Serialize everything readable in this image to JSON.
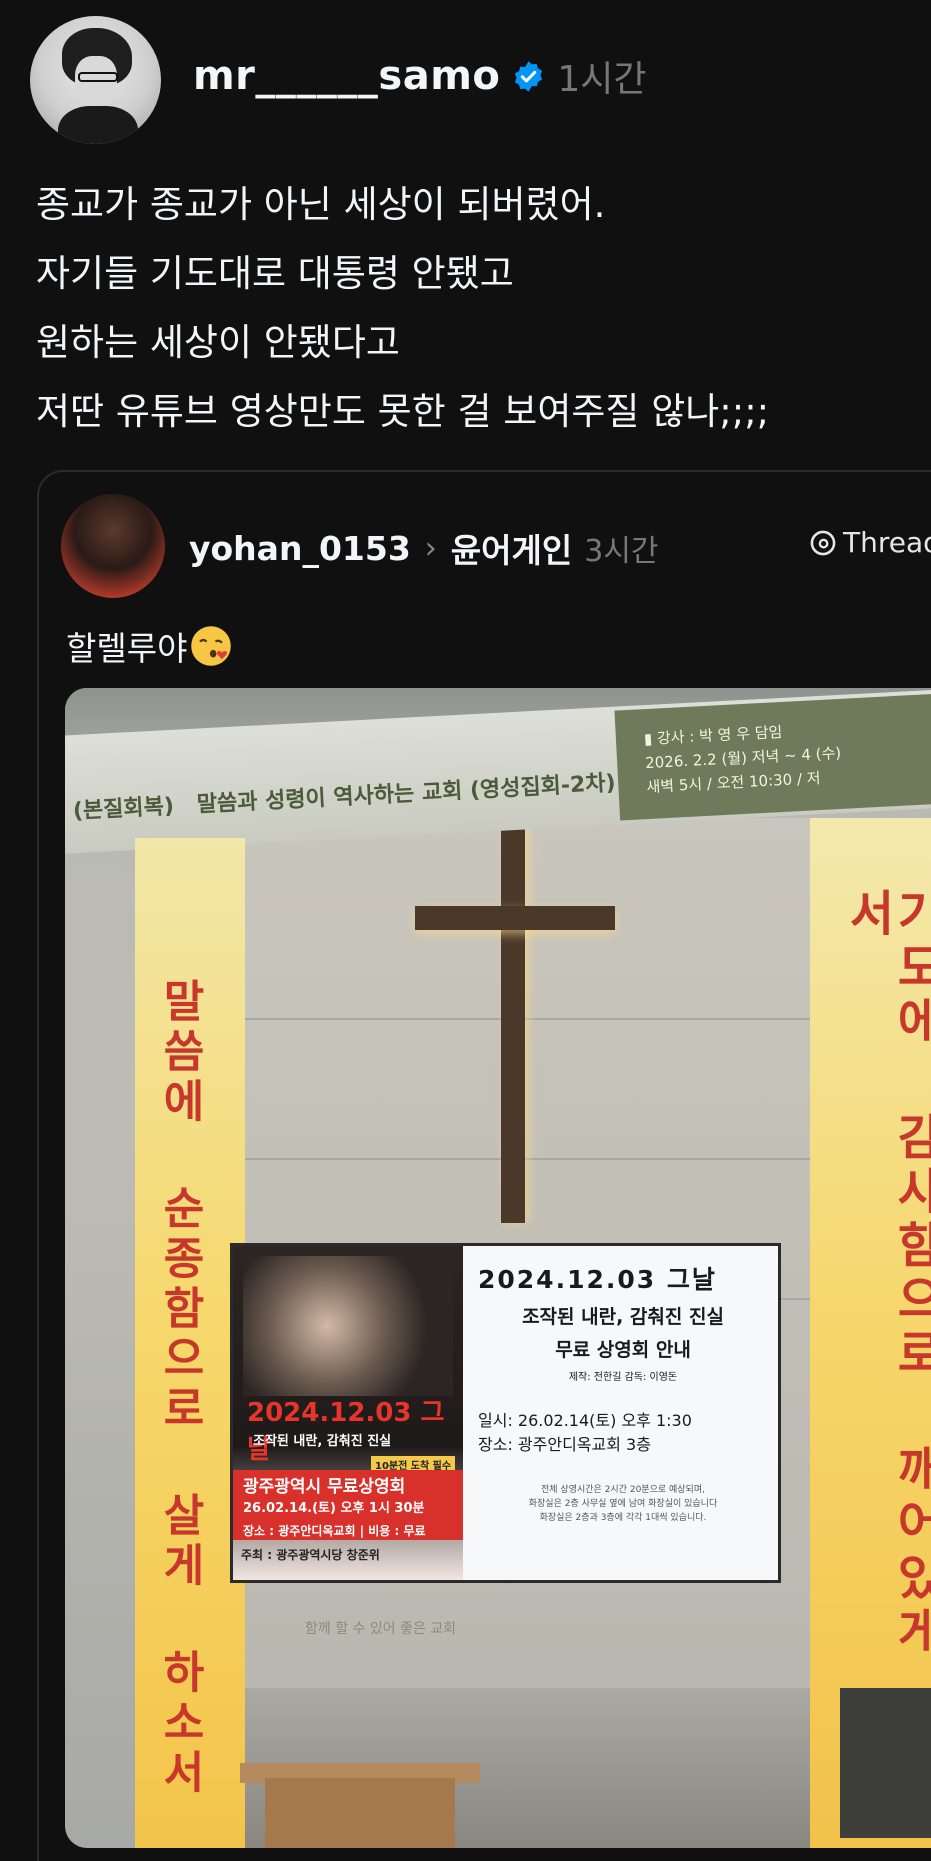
{
  "post": {
    "username": "mr______samo",
    "time": "1시간",
    "text": "종교가 종교가 아닌 세상이 되버렸어.\n자기들 기도대로 대통령 안됐고\n원하는 세상이 안됐다고\n저딴 유튜브 영상만도 못한 걸 보여주질 않나;;;;"
  },
  "quote": {
    "username": "yohan_0153",
    "topic": "윤어게인",
    "time": "3시간",
    "source_label": "Threads",
    "text": "할렐루야",
    "photo": {
      "banner_top": "말씀과 성령이 역사하는 교회 (영성집회-2차)",
      "banner_top_left": "(본질회복)",
      "banner_speaker": "▮ 강사 : 박 영 우 담임",
      "banner_dates": "2026. 2.2 (월) 저녁 ~ 4 (수)",
      "banner_times": "새벽 5시 / 오전 10:30 / 저",
      "pillar_left": "말씀에 순종함으로 살게 하소서",
      "pillar_right": "기도에 감사함으로 깨어있게 하소서",
      "screen": {
        "title": "2024.12.03 그날",
        "subtitle": "조작된 내란, 감춰진 진실",
        "subtitle2": "무료 상영회 안내",
        "credit": "제작: 전한길 감독: 이영돈",
        "info": "일시: 26.02.14(토) 오후 1:30\n장소: 광주안디옥교회 3층",
        "note": "전체 상영시간은 2시간 20분으로 예상되며,\n화장실은 2층 사무실 옆에 남여 화장실이 있습니다\n화장실은 2층과 3층에 각각 1대씩 있습니다.",
        "poster_date": "2024.12.03 그날",
        "poster_sub": "조작된 내란, 감춰진 진실",
        "poster_badge": "10분전 도착 필수",
        "poster_red1": "광주광역시 무료상영회",
        "poster_red2": "26.02.14.(토) 오후 1시 30분",
        "poster_red3": "장소 : 광주안디옥교회 | 비용 : 무료",
        "poster_foot": "주최 : 광주광역시당 창준위"
      },
      "wall_small_text": "함께 할 수 있어 좋은 교회"
    }
  }
}
